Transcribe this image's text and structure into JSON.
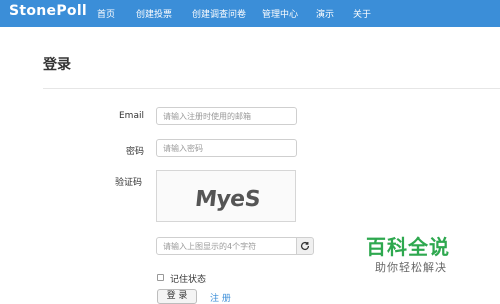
{
  "navbar": {
    "brand": "StonePoll",
    "items": [
      {
        "label": "首页"
      },
      {
        "label": "创建投票"
      },
      {
        "label": "创建调查问卷"
      },
      {
        "label": "管理中心"
      },
      {
        "label": "演示"
      },
      {
        "label": "关于"
      }
    ]
  },
  "page": {
    "title": "登录"
  },
  "form": {
    "email_label": "Email",
    "email_placeholder": "请输入注册时使用的邮箱",
    "password_label": "密码",
    "password_placeholder": "请输入密码",
    "captcha_label": "验证码",
    "captcha_image_text": "MyeS",
    "captcha_placeholder": "请输入上图显示的4个字符",
    "remember_label": "记住状态",
    "login_button": "登 录",
    "register_link": "注 册"
  },
  "watermark": {
    "main": "百科全说",
    "sub": "助你轻松解决"
  },
  "colors": {
    "navbar_bg": "#3b8ed8",
    "link": "#3b8ed8",
    "watermark_green": "#2ea84f"
  },
  "icons": {
    "refresh": "refresh-icon"
  }
}
